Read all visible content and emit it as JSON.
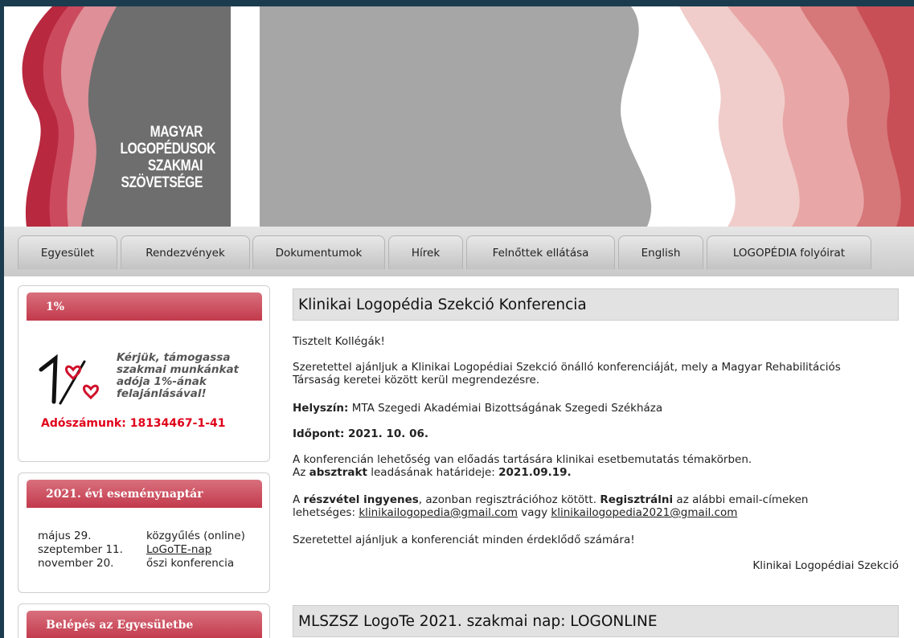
{
  "logo": {
    "lines": [
      "MAGYAR",
      "LOGOPÉDUSOK",
      "SZAKMAI",
      "SZÖVETSÉGE"
    ]
  },
  "colors": {
    "brand_red": "#c23a4c",
    "banner_gray": "#a6a6a6",
    "logo_gray": "#6e6e6e",
    "tax_red": "#e0001a"
  },
  "nav": {
    "items": [
      {
        "label": "Egyesület"
      },
      {
        "label": "Rendezvények"
      },
      {
        "label": "Dokumentumok"
      },
      {
        "label": "Hírek"
      },
      {
        "label": "Felnőttek ellátása"
      },
      {
        "label": "English"
      },
      {
        "label": "LOGOPÉDIA folyóirat"
      }
    ]
  },
  "sidebar": {
    "one_percent": {
      "title": "1%",
      "graphic": "1% heart graphic",
      "appeal_lines": [
        "Kérjük, támogassa",
        "szakmai munkánkat",
        "adója 1%-ának",
        "felajánlásával!"
      ],
      "tax_number": "Adószámunk: 18134467-1-41"
    },
    "calendar": {
      "title": "2021. évi eseménynaptár",
      "events": [
        {
          "date": "május 29.",
          "name": "közgyűlés (online)"
        },
        {
          "date": "szeptember 11.",
          "name": "LoGoTE-nap"
        },
        {
          "date": "november 20.",
          "name": "őszi konferencia"
        }
      ]
    },
    "login": {
      "title": "Belépés az Egyesületbe"
    }
  },
  "articles": [
    {
      "title": "Klinikai Logopédia Szekció Konferencia",
      "greeting": "Tisztelt Kollégák!",
      "intro_line1": "Szeretettel ajánljuk a Klinikai Logopédiai Szekció önálló konferenciáját, mely a Magyar Rehabilitációs",
      "intro_line2": "Társaság keretei között kerül megrendezésre.",
      "location_label": "Helyszín:",
      "location": "MTA Szegedi Akadémiai Bizottságának Szegedi Székháza",
      "date_label": "Időpont: 2021. 10. 06.",
      "presentation_line": "A konferencián lehetőség van előadás tartására klinikai esetbemutatás témakörben.",
      "abstract_pre": "Az ",
      "abstract_bold": "absztrakt",
      "abstract_mid": " leadásának határideje: ",
      "abstract_deadline": "2021.09.19.",
      "participation_pre": "A ",
      "participation_bold": "részvétel ingyenes",
      "participation_mid": ", azonban regisztrációhoz kötött. ",
      "register_bold": "Regisztrálni",
      "register_post": " az alábbi email-címeken",
      "email_pre": "lehetséges: ",
      "email1": "klinikailogopedia@gmail.com",
      "email_or": " vagy ",
      "email2": "klinikailogopedia2021@gmail.com",
      "closing": "Szeretettel ajánljuk a konferenciát minden érdeklődő számára!",
      "signature": "Klinikai Logopédiai Szekció"
    },
    {
      "title": "MLSZSZ LogoTe 2021. szakmai nap: LOGONLINE"
    }
  ]
}
